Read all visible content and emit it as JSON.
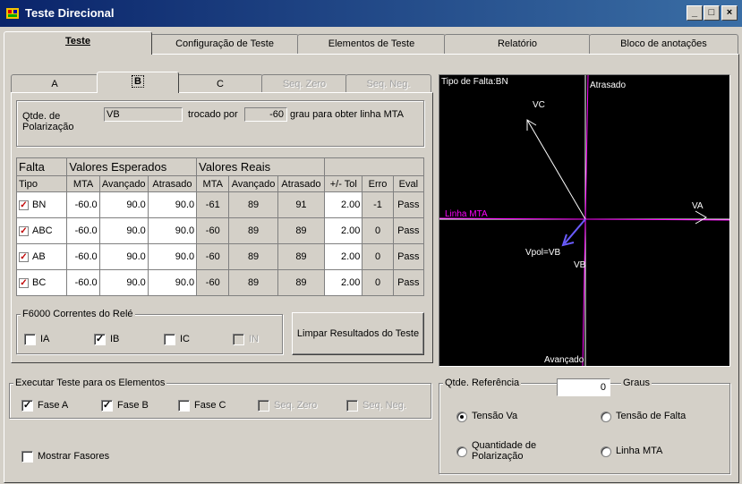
{
  "window": {
    "title": "Teste Direcional",
    "minimize": "_",
    "maximize": "□",
    "close": "×"
  },
  "main_tabs": [
    {
      "label": "Teste"
    },
    {
      "label": "Configuração de Teste"
    },
    {
      "label": "Elementos de Teste"
    },
    {
      "label": "Relatório"
    },
    {
      "label": "Bloco de anotações"
    }
  ],
  "sub_tabs": [
    {
      "label": "A"
    },
    {
      "label": "B"
    },
    {
      "label": "C"
    },
    {
      "label": "Seq. Zero"
    },
    {
      "label": "Seq. Neg."
    }
  ],
  "polarization": {
    "label": "Qtde. de Polarização",
    "value": "VB",
    "swapped_by": "trocado por",
    "degrees": "-60",
    "suffix": "grau para obter linha MTA"
  },
  "table": {
    "group_headers": {
      "fault": "Falta",
      "expected": "Valores Esperados",
      "actual": "Valores Reais"
    },
    "columns": [
      "Tipo",
      "MTA",
      "Avançado",
      "Atrasado",
      "MTA",
      "Avançado",
      "Atrasado",
      "+/- Tol",
      "Erro",
      "Eval"
    ],
    "rows": [
      {
        "type": "BN",
        "mta": "-60.0",
        "adv": "90.0",
        "lag": "90.0",
        "r_mta": "-61",
        "r_adv": "89",
        "r_lag": "91",
        "tol": "2.00",
        "err": "-1",
        "eval": "Pass"
      },
      {
        "type": "ABC",
        "mta": "-60.0",
        "adv": "90.0",
        "lag": "90.0",
        "r_mta": "-60",
        "r_adv": "89",
        "r_lag": "89",
        "tol": "2.00",
        "err": "0",
        "eval": "Pass"
      },
      {
        "type": "AB",
        "mta": "-60.0",
        "adv": "90.0",
        "lag": "90.0",
        "r_mta": "-60",
        "r_adv": "89",
        "r_lag": "89",
        "tol": "2.00",
        "err": "0",
        "eval": "Pass"
      },
      {
        "type": "BC",
        "mta": "-60.0",
        "adv": "90.0",
        "lag": "90.0",
        "r_mta": "-60",
        "r_adv": "89",
        "r_lag": "89",
        "tol": "2.00",
        "err": "0",
        "eval": "Pass"
      }
    ]
  },
  "relay_currents": {
    "label": "F6000 Correntes do Relé",
    "items": [
      {
        "label": "IA",
        "checked": false,
        "disabled": false
      },
      {
        "label": "IB",
        "checked": true,
        "disabled": false
      },
      {
        "label": "IC",
        "checked": false,
        "disabled": false
      },
      {
        "label": "IN",
        "checked": false,
        "disabled": true
      }
    ]
  },
  "clear_button": "Limpar Resultados do Teste",
  "execute": {
    "label": "Executar Teste para os Elementos",
    "items": [
      {
        "label": "Fase A",
        "checked": true,
        "disabled": false
      },
      {
        "label": "Fase B",
        "checked": true,
        "disabled": false
      },
      {
        "label": "Fase C",
        "checked": false,
        "disabled": false
      },
      {
        "label": "Seq. Zero",
        "checked": false,
        "disabled": true
      },
      {
        "label": "Seq. Neg.",
        "checked": false,
        "disabled": true
      }
    ]
  },
  "show_phasors": {
    "label": "Mostrar Fasores",
    "checked": false
  },
  "phasor": {
    "fault_type": "Tipo de Falta:BN",
    "lagging": "Atrasado",
    "leading": "Avançado",
    "mta_line": "Linha MTA",
    "va": "VA",
    "vc": "VC",
    "vb": "VB",
    "vpol": "Vpol=VB",
    "colors": {
      "background": "#000000",
      "axes": "#ffffff",
      "mta": "#ff00ff",
      "vpol": "#6a5cff"
    }
  },
  "reference": {
    "label": "Qtde. Referência",
    "value": "0",
    "unit": "Graus",
    "options": [
      {
        "label": "Tensão Va",
        "selected": true
      },
      {
        "label": "Tensão de Falta",
        "selected": false
      },
      {
        "label": "Quantidade de Polarização",
        "selected": false
      },
      {
        "label": "Linha MTA",
        "selected": false
      }
    ]
  }
}
